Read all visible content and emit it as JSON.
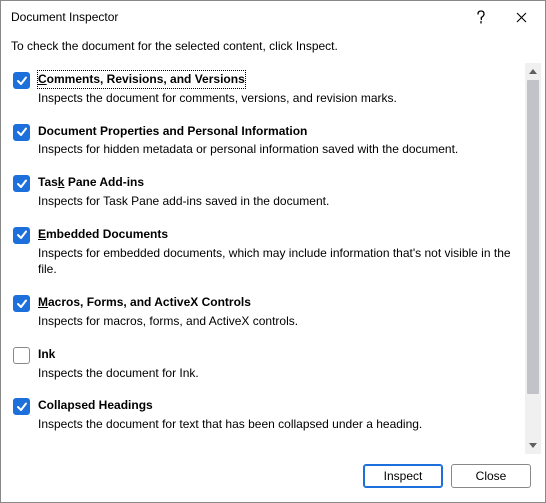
{
  "titlebar": {
    "title": "Document Inspector"
  },
  "subtitle": "To check the document for the selected content, click Inspect.",
  "items": [
    {
      "label": "Comments, Revisions, and Versions",
      "accesskey": "C",
      "checked": true,
      "focused": true,
      "desc": "Inspects the document for comments, versions, and revision marks."
    },
    {
      "label": "Document Properties and Personal Information",
      "accesskey": "",
      "checked": true,
      "focused": false,
      "desc": "Inspects for hidden metadata or personal information saved with the document."
    },
    {
      "label": "Task Pane Add-ins",
      "accesskey": "k",
      "checked": true,
      "focused": false,
      "desc": "Inspects for Task Pane add-ins saved in the document."
    },
    {
      "label": "Embedded Documents",
      "accesskey": "E",
      "checked": true,
      "focused": false,
      "desc": "Inspects for embedded documents, which may include information that's not visible in the file."
    },
    {
      "label": "Macros, Forms, and ActiveX Controls",
      "accesskey": "M",
      "checked": true,
      "focused": false,
      "desc": "Inspects for macros, forms, and ActiveX controls."
    },
    {
      "label": "Ink",
      "accesskey": "",
      "checked": false,
      "focused": false,
      "desc": "Inspects the document for Ink."
    },
    {
      "label": "Collapsed Headings",
      "accesskey": "",
      "checked": true,
      "focused": false,
      "desc": "Inspects the document for text that has been collapsed under a heading."
    }
  ],
  "footer": {
    "inspect": "Inspect",
    "inspect_accesskey": "I",
    "close": "Close",
    "close_accesskey": "C"
  }
}
